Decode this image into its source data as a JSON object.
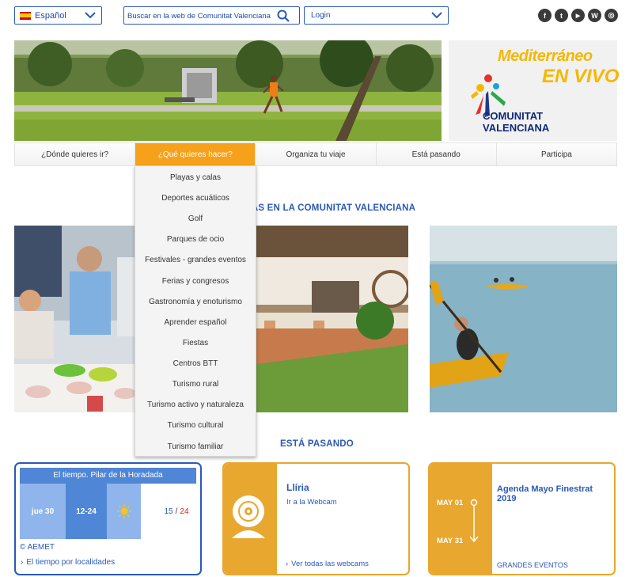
{
  "header": {
    "language": "Español",
    "search_placeholder": "Buscar en la web de Comunitat Valenciana",
    "login": "Login",
    "social": [
      {
        "name": "facebook-icon",
        "glyph": "f"
      },
      {
        "name": "twitter-icon",
        "glyph": "t"
      },
      {
        "name": "youtube-icon",
        "glyph": "▶"
      },
      {
        "name": "wordpress-icon",
        "glyph": "W"
      },
      {
        "name": "instagram-icon",
        "glyph": "◎"
      }
    ]
  },
  "brand": {
    "slogan_line1": "Mediterráneo",
    "slogan_line2": "EN VIVO",
    "name_line1": "COMUNITAT",
    "name_line2": "VALENCIANA"
  },
  "nav": {
    "tabs": [
      {
        "label": "¿Dónde quieres ir?"
      },
      {
        "label": "¿Qué quieres hacer?"
      },
      {
        "label": "Organiza tu viaje"
      },
      {
        "label": "Está pasando"
      },
      {
        "label": "Participa"
      }
    ],
    "active_index": 1
  },
  "dropdown": {
    "items": [
      "Playas y calas",
      "Deportes acuáticos",
      "Golf",
      "Parques de ocio",
      "Festivales - grandes eventos",
      "Ferias y congresos",
      "Gastronomía y enoturismo",
      "Aprender español",
      "Fiestas",
      "Centros BTT",
      "Turismo rural",
      "Turismo activo y naturaleza",
      "Turismo cultural",
      "Turismo familiar"
    ]
  },
  "sections": {
    "experiences_title": "CIAS EN LA COMUNITAT VALENCIANA",
    "events_title": "ESTÁ PASANDO"
  },
  "weather": {
    "title": "El tiempo. Pilar de la Horadada",
    "day": "jue 30",
    "hours": "12-24",
    "temp_min": "15",
    "temp_sep": "/",
    "temp_max": "24",
    "source": "© AEMET",
    "link": "El tiempo por localidades",
    "colors": {
      "head": "#4f86d6",
      "cell_light": "#8fb5ec",
      "cell_dark": "#4f86d6",
      "max": "#e0261c"
    }
  },
  "webcam": {
    "title": "Llíria",
    "subtitle": "Ir a la Webcam",
    "link": "Ver todas las webcams"
  },
  "agenda": {
    "date_start": "MAY 01",
    "date_end": "MAY 31",
    "title": "Agenda Mayo Finestrat 2019",
    "category": "GRANDES EVENTOS"
  },
  "colors": {
    "primary_blue": "#2a59b8",
    "accent_orange": "#f7a11a",
    "card_orange": "#e8a72e"
  }
}
